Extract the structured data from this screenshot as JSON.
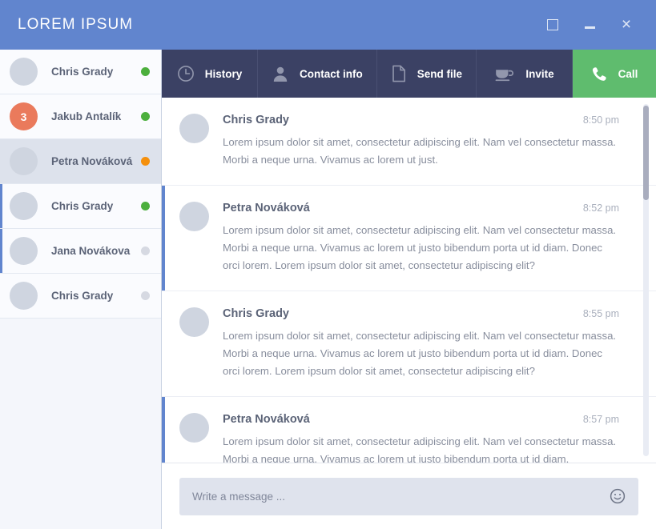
{
  "window": {
    "title": "LOREM IPSUM",
    "controls": [
      {
        "name": "maximize-button",
        "glyph": "maximize"
      },
      {
        "name": "minimize-button",
        "glyph": "minimize"
      },
      {
        "name": "close-button",
        "glyph": "×"
      }
    ],
    "accent_color": "#6185ce"
  },
  "sidebar": {
    "contacts": [
      {
        "name": "Chris Grady",
        "status": "online",
        "status_color": "#4caf3d",
        "avatar": "av-a",
        "badge": null,
        "selected": false,
        "accent": false
      },
      {
        "name": "Jakub Antalík",
        "status": "online",
        "status_color": "#4caf3d",
        "avatar": null,
        "badge": "3",
        "selected": false,
        "accent": false
      },
      {
        "name": "Petra Nováková",
        "status": "away",
        "status_color": "#f5900c",
        "avatar": "av-b",
        "badge": null,
        "selected": true,
        "accent": false
      },
      {
        "name": "Chris Grady",
        "status": "online",
        "status_color": "#4caf3d",
        "avatar": "av-c",
        "badge": null,
        "selected": false,
        "accent": true
      },
      {
        "name": "Jana Novákova",
        "status": "offline",
        "status_color": "#d6d9e2",
        "avatar": "av-d",
        "badge": null,
        "selected": false,
        "accent": true
      },
      {
        "name": "Chris Grady",
        "status": "offline",
        "status_color": "#d6d9e2",
        "avatar": "av-c",
        "badge": null,
        "selected": false,
        "accent": false
      }
    ]
  },
  "toolbar": {
    "items": [
      {
        "label": "History",
        "icon": "clock-icon",
        "active": false
      },
      {
        "label": "Contact info",
        "icon": "person-icon",
        "active": false
      },
      {
        "label": "Send file",
        "icon": "document-icon",
        "active": false
      },
      {
        "label": "Invite",
        "icon": "coffee-cup-icon",
        "active": false
      },
      {
        "label": "Call",
        "icon": "phone-icon",
        "active": true
      }
    ],
    "call_color": "#5fbc6e",
    "background_color": "#3b4164"
  },
  "messages": [
    {
      "author": "Chris Grady",
      "time": "8:50 pm",
      "avatar": "av-c",
      "accent": false,
      "text": "Lorem ipsum dolor sit amet, consectetur adipiscing elit. Nam vel consectetur massa. Morbi a neque urna. Vivamus ac lorem ut just."
    },
    {
      "author": "Petra Nováková",
      "time": "8:52 pm",
      "avatar": "av-b",
      "accent": true,
      "text": "Lorem ipsum dolor sit amet, consectetur adipiscing elit. Nam vel consectetur massa. Morbi a neque urna. Vivamus ac lorem ut justo bibendum porta ut id diam. Donec orci lorem. Lorem ipsum dolor sit amet, consectetur adipiscing elit?"
    },
    {
      "author": "Chris Grady",
      "time": "8:55 pm",
      "avatar": "av-c",
      "accent": false,
      "text": "Lorem ipsum dolor sit amet, consectetur adipiscing elit. Nam vel consectetur massa. Morbi a neque urna. Vivamus ac lorem ut justo bibendum porta ut id diam. Donec orci lorem. Lorem ipsum dolor sit amet, consectetur adipiscing elit?"
    },
    {
      "author": "Petra Nováková",
      "time": "8:57 pm",
      "avatar": "av-b",
      "accent": true,
      "text": "Lorem ipsum dolor sit amet, consectetur adipiscing elit. Nam vel consectetur massa. Morbi a neque urna. Vivamus ac lorem ut justo bibendum porta ut id diam."
    }
  ],
  "composer": {
    "placeholder": "Write a message ...",
    "emoji_icon": "smiley-icon"
  }
}
